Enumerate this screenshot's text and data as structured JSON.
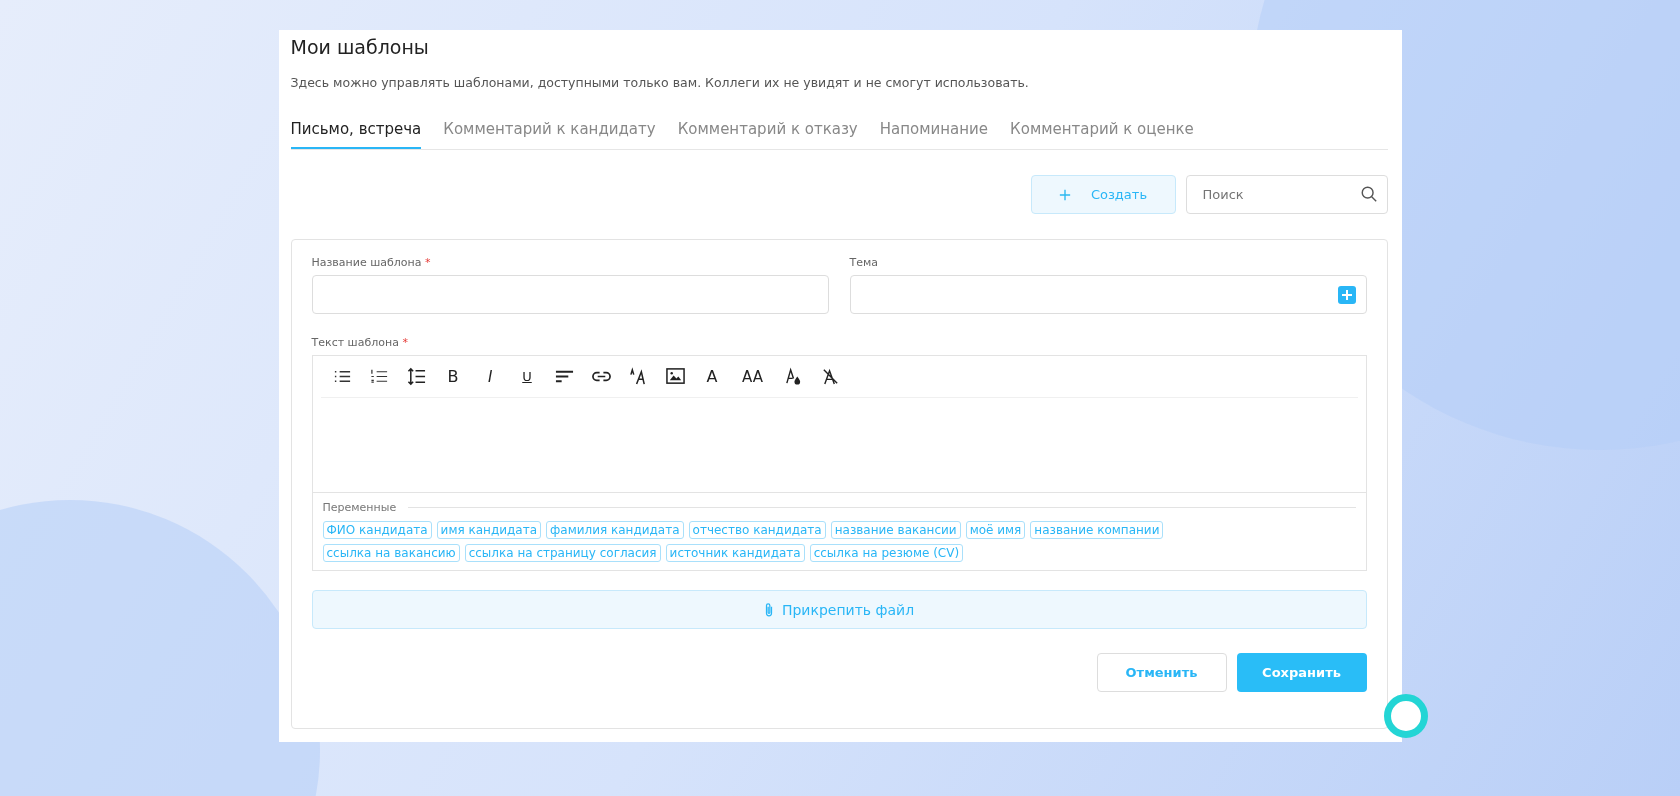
{
  "title": "Мои шаблоны",
  "description": "Здесь можно управлять шаблонами, доступными только вам. Коллеги их не увидят и не смогут использовать.",
  "tabs": [
    {
      "label": "Письмо, встреча",
      "selected": true
    },
    {
      "label": "Комментарий к кандидату",
      "selected": false
    },
    {
      "label": "Комментарий к отказу",
      "selected": false
    },
    {
      "label": "Напоминание",
      "selected": false
    },
    {
      "label": "Комментарий к оценке",
      "selected": false
    }
  ],
  "create_button": {
    "label": "Создать"
  },
  "search": {
    "placeholder": "Поиск"
  },
  "form": {
    "name_field": {
      "label": "Название шаблона",
      "required_mark": "*"
    },
    "subject_field": {
      "label": "Тема"
    },
    "text_field": {
      "label": "Текст шаблона",
      "required_mark": "*"
    },
    "toolbar": [
      {
        "kind": "bullet-list"
      },
      {
        "kind": "numbered-list"
      },
      {
        "kind": "line-height"
      },
      {
        "kind": "bold",
        "glyph": "B"
      },
      {
        "kind": "italic",
        "glyph": "I"
      },
      {
        "kind": "underline",
        "glyph": "U"
      },
      {
        "kind": "align"
      },
      {
        "kind": "link"
      },
      {
        "kind": "font-family"
      },
      {
        "kind": "image"
      },
      {
        "kind": "font",
        "glyph": "A"
      },
      {
        "kind": "font-size",
        "glyph": "AA"
      },
      {
        "kind": "text-color"
      },
      {
        "kind": "clear-format"
      }
    ],
    "variables_label": "Переменные",
    "variables": [
      "ФИО кандидата",
      "имя кандидата",
      "фамилия кандидата",
      "отчество кандидата",
      "название вакансии",
      "моё имя",
      "название компании",
      "ссылка на вакансию",
      "ссылка на страницу согласия",
      "источник кандидата",
      "ссылка на резюме (CV)"
    ],
    "attach_button": "Прикрепить файл",
    "cancel_button": "Отменить",
    "save_button": "Сохранить"
  }
}
